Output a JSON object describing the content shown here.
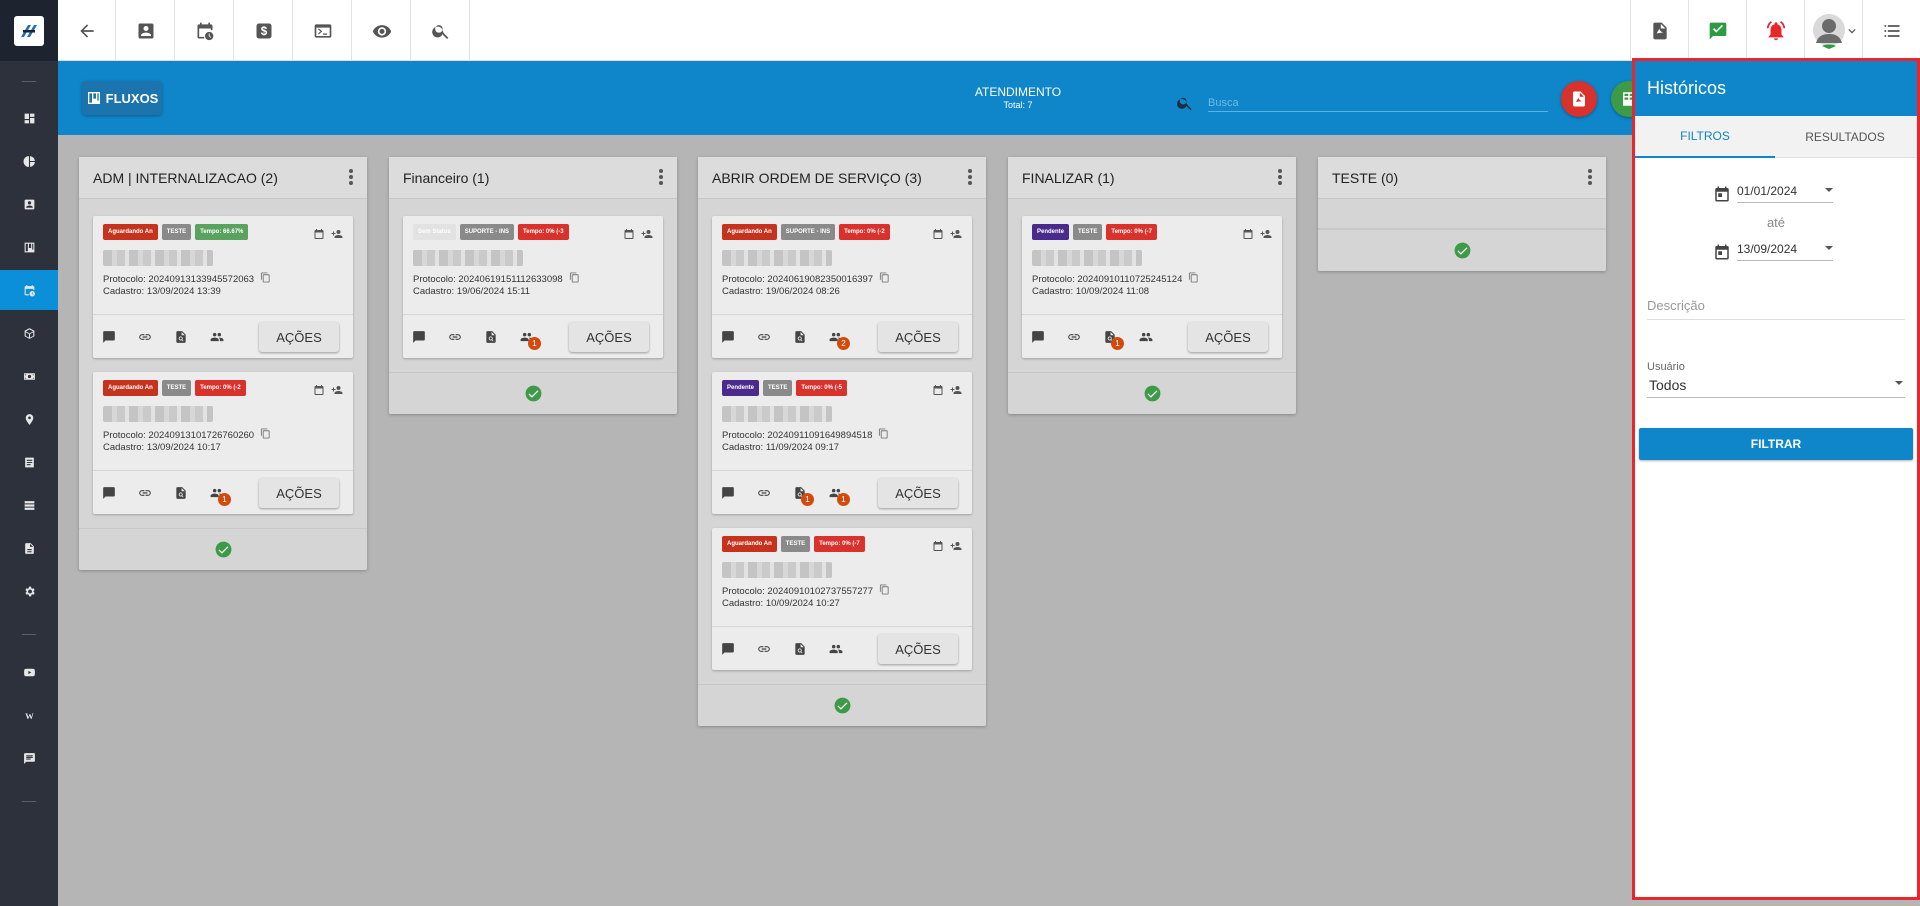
{
  "header": {
    "fluxos_label": "FLUXOS",
    "title": "ATENDIMENTO",
    "total": "Total: 7",
    "search_placeholder": "Busca"
  },
  "columns": [
    {
      "title": "ADM | INTERNALIZACAO (2)",
      "cards": [
        {
          "badges": [
            {
              "text": "Aguardando An",
              "color": "#c5331f"
            },
            {
              "text": "TESTE",
              "color": "#8a8a8a"
            },
            {
              "text": "Tempo: 66.67%",
              "color": "#5aa35e"
            }
          ],
          "protocol": "Protocolo: 20240913133945572063",
          "cadastro": "Cadastro: 13/09/2024 13:39",
          "counts": {
            "docs": "",
            "users": ""
          },
          "action": "AÇÕES"
        },
        {
          "badges": [
            {
              "text": "Aguardando An",
              "color": "#c5331f"
            },
            {
              "text": "TESTE",
              "color": "#8a8a8a"
            },
            {
              "text": "Tempo: 0% (-2",
              "color": "#d9312b"
            }
          ],
          "protocol": "Protocolo: 20240913101726760260",
          "cadastro": "Cadastro: 13/09/2024 10:17",
          "counts": {
            "docs": "",
            "users": "1"
          },
          "action": "AÇÕES"
        }
      ]
    },
    {
      "title": "Financeiro (1)",
      "cards": [
        {
          "badges": [
            {
              "text": "Sem Status",
              "color": "#e2e2e2"
            },
            {
              "text": "SUPORTE - INS",
              "color": "#8a8a8a"
            },
            {
              "text": "Tempo: 0% (-3",
              "color": "#d9312b"
            }
          ],
          "protocol": "Protocolo: 20240619151112633098",
          "cadastro": "Cadastro: 19/06/2024 15:11",
          "counts": {
            "docs": "",
            "users": "1"
          },
          "action": "AÇÕES"
        }
      ]
    },
    {
      "title": "ABRIR ORDEM DE SERVIÇO (3)",
      "cards": [
        {
          "badges": [
            {
              "text": "Aguardando An",
              "color": "#c5331f"
            },
            {
              "text": "SUPORTE - INS",
              "color": "#8a8a8a"
            },
            {
              "text": "Tempo: 0% (-2",
              "color": "#d9312b"
            }
          ],
          "protocol": "Protocolo: 20240619082350016397",
          "cadastro": "Cadastro: 19/06/2024 08:26",
          "counts": {
            "docs": "",
            "users": "2"
          },
          "action": "AÇÕES"
        },
        {
          "badges": [
            {
              "text": "Pendente",
              "color": "#4a2a8c"
            },
            {
              "text": "TESTE",
              "color": "#8a8a8a"
            },
            {
              "text": "Tempo: 0% (-5",
              "color": "#d9312b"
            }
          ],
          "protocol": "Protocolo: 20240911091649894518",
          "cadastro": "Cadastro: 11/09/2024 09:17",
          "counts": {
            "docs": "1",
            "users": "1"
          },
          "action": "AÇÕES"
        },
        {
          "badges": [
            {
              "text": "Aguardando An",
              "color": "#c5331f"
            },
            {
              "text": "TESTE",
              "color": "#8a8a8a"
            },
            {
              "text": "Tempo: 0% (-7",
              "color": "#d9312b"
            }
          ],
          "protocol": "Protocolo: 20240910102737557277",
          "cadastro": "Cadastro: 10/09/2024 10:27",
          "counts": {
            "docs": "",
            "users": ""
          },
          "action": "AÇÕES"
        }
      ]
    },
    {
      "title": "FINALIZAR (1)",
      "cards": [
        {
          "badges": [
            {
              "text": "Pendente",
              "color": "#4a2a8c"
            },
            {
              "text": "TESTE",
              "color": "#8a8a8a"
            },
            {
              "text": "Tempo: 0% (-7",
              "color": "#d9312b"
            }
          ],
          "protocol": "Protocolo: 20240910110725245124",
          "cadastro": "Cadastro: 10/09/2024 11:08",
          "counts": {
            "docs": "1",
            "users": ""
          },
          "action": "AÇÕES"
        }
      ]
    },
    {
      "title": "TESTE (0)",
      "cards": []
    }
  ],
  "historicos": {
    "title": "Históricos",
    "tabs": [
      "FILTROS",
      "RESULTADOS"
    ],
    "date_from": "01/01/2024",
    "ate": "até",
    "date_to": "13/09/2024",
    "descricao_placeholder": "Descrição",
    "usuario_label": "Usuário",
    "usuario_value": "Todos",
    "filter_button": "FILTRAR"
  },
  "colors": {
    "primary": "#0f86c9",
    "sidebar": "#2c313c",
    "highlight_border": "#e8262c",
    "success": "#3d9b48"
  }
}
